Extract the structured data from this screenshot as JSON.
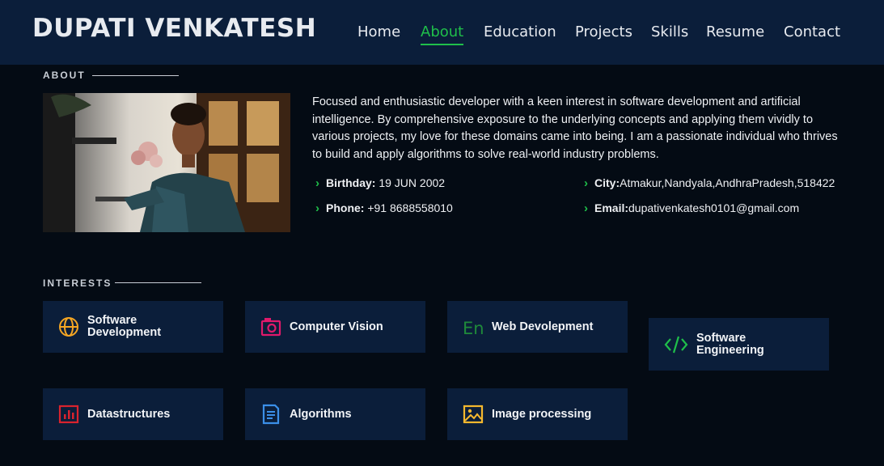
{
  "header": {
    "brand": "DUPATI VENKATESH",
    "nav": [
      "Home",
      "About",
      "Education",
      "Projects",
      "Skills",
      "Resume",
      "Contact"
    ],
    "active": "About"
  },
  "about": {
    "title": "ABOUT",
    "paragraph": "Focused and enthusiastic developer with a keen interest in software development and artificial intelligence. By comprehensive exposure to the underlying concepts and applying them vividly to various projects, my love for these domains came into being. I am a passionate individual who thrives to build and apply algorithms to solve real-world industry problems.",
    "info": {
      "birthday_label": "Birthday:",
      "birthday": "19 JUN 2002",
      "phone_label": "Phone:",
      "phone": "+91 8688558010",
      "city_label": "City:",
      "city": "Atmakur,Nandyala,AndhraPradesh,518422",
      "email_label": "Email:",
      "email": "dupativenkatesh0101@gmail.com"
    }
  },
  "interests": {
    "title": "INTERESTS",
    "items": [
      {
        "label_1": "Software",
        "label_2": "Development",
        "icon": "globe-icon",
        "color": "#f5a623"
      },
      {
        "label_1": "Computer Vision",
        "label_2": "",
        "icon": "camera-icon",
        "color": "#e0196b"
      },
      {
        "label_1": "Web Devolepment",
        "label_2": "",
        "icon": "language-icon",
        "color": "#1f8a3a"
      },
      {
        "label_1": "Software",
        "label_2": "Engineering",
        "icon": "code-icon",
        "color": "#1fbf4a"
      },
      {
        "label_1": "Datastructures",
        "label_2": "",
        "icon": "bar-chart-icon",
        "color": "#d9232e"
      },
      {
        "label_1": "Algorithms",
        "label_2": "",
        "icon": "document-icon",
        "color": "#3b8fe8"
      },
      {
        "label_1": "Image processing",
        "label_2": "",
        "icon": "image-icon",
        "color": "#f5b82e"
      }
    ]
  }
}
